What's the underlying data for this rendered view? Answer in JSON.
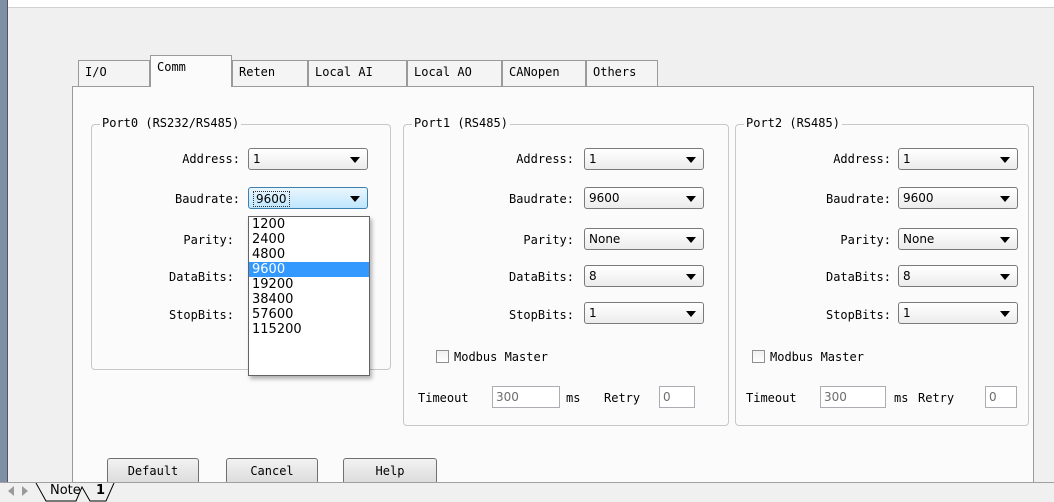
{
  "tabs": [
    "I/O",
    "Comm",
    "Reten",
    "Local AI",
    "Local AO",
    "CANopen",
    "Others"
  ],
  "active_tab": "Comm",
  "labels": {
    "address": "Address:",
    "baudrate": "Baudrate:",
    "parity": "Parity:",
    "databits": "DataBits:",
    "stopbits": "StopBits:",
    "modbus_master": "Modbus Master",
    "timeout": "Timeout",
    "ms": "ms",
    "retry": "Retry"
  },
  "ports": [
    {
      "title": "Port0 (RS232/RS485)",
      "address": "1",
      "baudrate": "9600"
    },
    {
      "title": "Port1 (RS485)",
      "address": "1",
      "baudrate": "9600",
      "parity": "None",
      "databits": "8",
      "stopbits": "1",
      "modbus_master": false,
      "timeout": "300",
      "retry": "0"
    },
    {
      "title": "Port2 (RS485)",
      "address": "1",
      "baudrate": "9600",
      "parity": "None",
      "databits": "8",
      "stopbits": "1",
      "modbus_master": false,
      "timeout": "300",
      "retry": "0"
    }
  ],
  "baudrate_dropdown": {
    "options": [
      "1200",
      "2400",
      "4800",
      "9600",
      "19200",
      "38400",
      "57600",
      "115200"
    ],
    "highlighted": "9600"
  },
  "buttons": {
    "default": "Default",
    "cancel": "Cancel",
    "help": "Help"
  },
  "sheet_tabs": {
    "note": "Note",
    "sheet1": "1"
  },
  "colors": {
    "highlight": "#3399ff",
    "focus_border": "#3c7fb1"
  }
}
